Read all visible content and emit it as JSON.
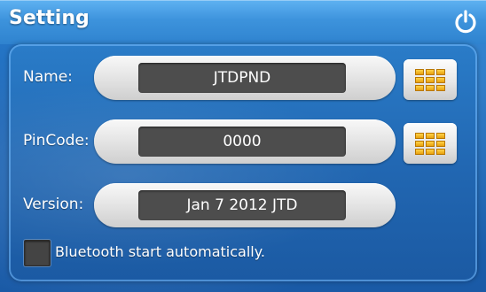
{
  "window": {
    "title": "Setting"
  },
  "settings": {
    "name": {
      "label": "Name:",
      "value": "JTDPND"
    },
    "pincode": {
      "label": "PinCode:",
      "value": "0000"
    },
    "version": {
      "label": "Version:",
      "value": "Jan  7 2012 JTD"
    }
  },
  "bluetooth": {
    "label": "Bluetooth start automatically.",
    "checked": false
  },
  "icons": {
    "power": "power-icon",
    "keypad": "keypad-icon"
  },
  "colors": {
    "accent": "#2f83cf",
    "field_bg": "#4d4d4d",
    "keypad_yellow": "#f2b01e"
  }
}
